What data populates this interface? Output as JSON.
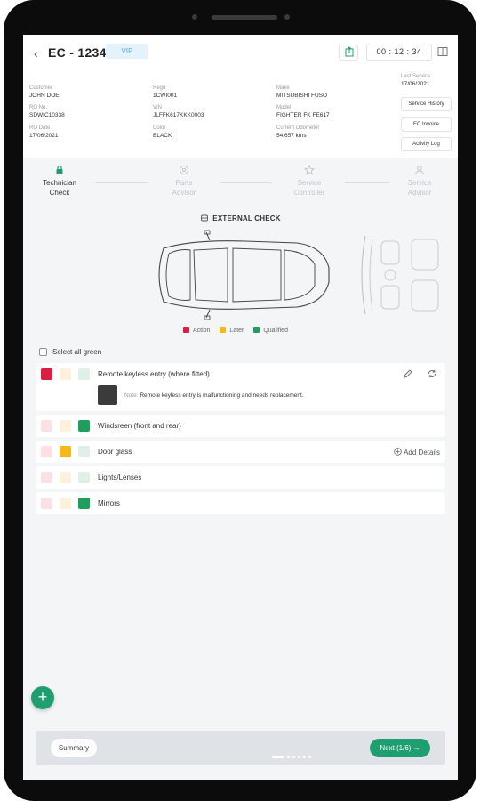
{
  "header": {
    "back_icon": "chevron-left-icon",
    "title": "EC - 12345",
    "badge": "VIP",
    "timer": "00 : 12 : 34",
    "share_icon": "share-icon",
    "split_icon": "split-view-icon"
  },
  "info": {
    "customer_label": "Customer",
    "customer_value": "JOHN DOE",
    "rego_label": "Rego",
    "rego_value": "1CWI001",
    "make_label": "Make",
    "make_value": "MITSUBISHI FUSO",
    "ro_no_label": "RO No.",
    "ro_no_value": "SDWIC10338",
    "vin_label": "VIN",
    "vin_value": "JLFFK617KKK0003",
    "model_label": "Model",
    "model_value": "FIGHTER FK FE617",
    "ro_date_label": "RO Date",
    "ro_date_value": "17/06/2021",
    "color_label": "Color",
    "color_value": "BLACK",
    "odometer_label": "Current Odometer",
    "odometer_value": "54,657 kms",
    "last_service_label": "Last Service",
    "last_service_value": "17/06/2021"
  },
  "side_buttons": {
    "service_history": "Service History",
    "ec_invoice": "EC Invoice",
    "activity_log": "Activity Log"
  },
  "steps": [
    {
      "label_1": "Technician",
      "label_2": "Check",
      "icon": "lock-icon",
      "active": true
    },
    {
      "label_1": "Parts",
      "label_2": "Advisor",
      "icon": "gear-icon",
      "active": false
    },
    {
      "label_1": "Service",
      "label_2": "Controller",
      "icon": "star-icon",
      "active": false
    },
    {
      "label_1": "Service",
      "label_2": "Advisor",
      "icon": "user-icon",
      "active": false
    }
  ],
  "external_check": {
    "title": "EXTERNAL CHECK",
    "icon": "car-seat-icon"
  },
  "legend": {
    "action": "Action",
    "later": "Later",
    "qualified": "Qualified"
  },
  "colors": {
    "action": "#d81f45",
    "later": "#f6b71b",
    "qualified": "#1f9f5e",
    "accent": "#1f9f70"
  },
  "select_all": "Select all green",
  "checks": [
    {
      "label": "Remote keyless entry (where fitted)",
      "status": "action",
      "note_label": "Note:",
      "note_text": "Remote keyless entry is malfunctioning and needs replacement."
    },
    {
      "label": "Windsreen (front and rear)",
      "status": "qualified"
    },
    {
      "label": "Door glass",
      "status": "later",
      "action": "Add Details"
    },
    {
      "label": "Lights/Lenses",
      "status": "none"
    },
    {
      "label": "Mirrors",
      "status": "qualified"
    }
  ],
  "footer": {
    "summary": "Summary",
    "next": "Next (1/6)",
    "fab": "+"
  }
}
